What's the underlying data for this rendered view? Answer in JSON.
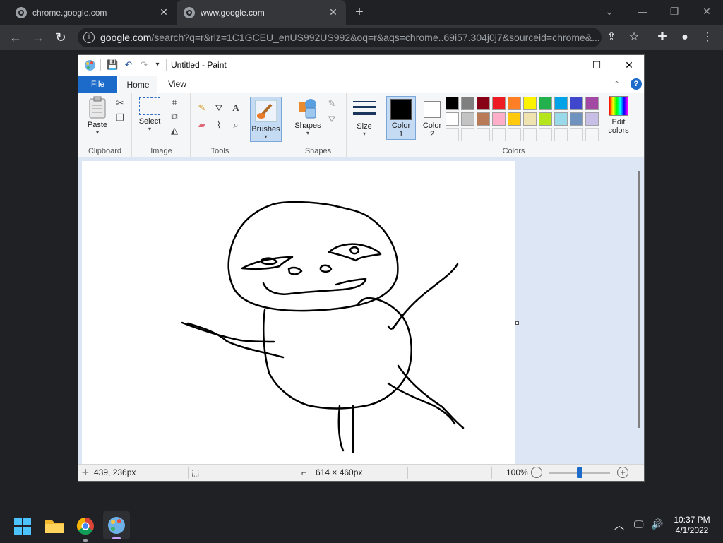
{
  "browser": {
    "tabs": [
      {
        "title": "chrome.google.com"
      },
      {
        "title": "www.google.com"
      }
    ],
    "url_host": "google.com",
    "url_rest": "/search?q=r&rlz=1C1GCEU_enUS992US992&oq=r&aqs=chrome..69i57.304j0j7&sourceid=chrome&..."
  },
  "paint": {
    "window_title": "Untitled - Paint",
    "ribbon_tabs": [
      "File",
      "Home",
      "View"
    ],
    "groups": {
      "clipboard": {
        "label": "Clipboard",
        "paste": "Paste"
      },
      "image": {
        "label": "Image",
        "select": "Select"
      },
      "tools": {
        "label": "Tools"
      },
      "brushes": {
        "label": "Brushes"
      },
      "shapes": {
        "label": "Shapes",
        "shapes_btn": "Shapes"
      },
      "size": {
        "label": "Size"
      },
      "colors": {
        "label": "Colors",
        "color1": "Color\n1",
        "color2": "Color\n2",
        "edit": "Edit\ncolors"
      }
    },
    "palette_row1": [
      "#000000",
      "#7f7f7f",
      "#880015",
      "#ed1c24",
      "#ff7f27",
      "#fff200",
      "#22b14c",
      "#00a2e8",
      "#3f48cc",
      "#a349a4"
    ],
    "palette_row2": [
      "#ffffff",
      "#c3c3c3",
      "#b97a57",
      "#ffaec9",
      "#ffc90e",
      "#efe4b0",
      "#b5e61d",
      "#99d9ea",
      "#7092be",
      "#c8bfe7"
    ],
    "color1_value": "#000000",
    "color2_value": "#ffffff",
    "status": {
      "cursor_pos": "439, 236px",
      "image_size": "614 × 460px",
      "zoom": "100%",
      "zoom_fraction": 0.5
    }
  },
  "taskbar": {
    "time": "10:37 PM",
    "date": "4/1/2022"
  }
}
